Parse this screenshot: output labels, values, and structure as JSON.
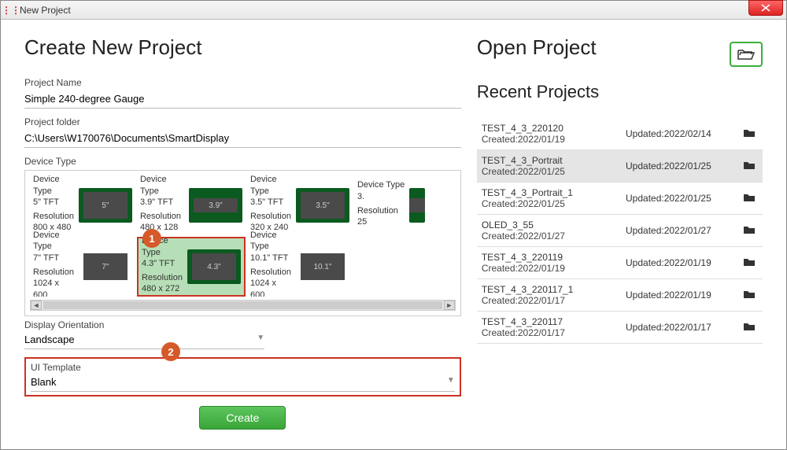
{
  "window": {
    "title": "New Project"
  },
  "create": {
    "heading": "Create New Project",
    "project_name_label": "Project Name",
    "project_name_value": "Simple 240-degree Gauge",
    "project_folder_label": "Project folder",
    "project_folder_value": "C:\\Users\\W170076\\Documents\\SmartDisplay",
    "device_type_label": "Device Type",
    "devices": [
      {
        "type": "5\" TFT",
        "res": "800 x 480",
        "thumb": "5\"",
        "shape": "normal"
      },
      {
        "type": "3.9\" TFT",
        "res": "480 x 128",
        "thumb": "3.9\"",
        "shape": "thin"
      },
      {
        "type": "3.5\" TFT",
        "res": "320 x 240",
        "thumb": "3.5\"",
        "shape": "normal"
      },
      {
        "type": "3.",
        "res": "25",
        "thumb": "",
        "shape": "thin",
        "cutoff": true
      },
      {
        "type": "7\" TFT",
        "res": "1024 x 600",
        "thumb": "7\"",
        "shape": "normal",
        "nogreen": true
      },
      {
        "type": "4.3\" TFT",
        "res": "480 x 272",
        "thumb": "4.3\"",
        "shape": "normal",
        "selected": true
      },
      {
        "type": "10.1\" TFT",
        "res": "1024 x 600",
        "thumb": "10.1\"",
        "shape": "normal",
        "nogreen": true
      }
    ],
    "device_field_labels": {
      "type": "Device Type",
      "res": "Resolution"
    },
    "orientation_label": "Display Orientation",
    "orientation_value": "Landscape",
    "uitemplate_label": "UI Template",
    "uitemplate_value": "Blank",
    "create_button": "Create"
  },
  "open": {
    "heading": "Open Project",
    "recent_heading": "Recent Projects",
    "recent": [
      {
        "name": "TEST_4_3_220120",
        "created": "2022/01/19",
        "updated": "2022/02/14"
      },
      {
        "name": "TEST_4_3_Portrait",
        "created": "2022/01/25",
        "updated": "2022/01/25",
        "selected": true
      },
      {
        "name": "TEST_4_3_Portrait_1",
        "created": "2022/01/25",
        "updated": "2022/01/25"
      },
      {
        "name": "OLED_3_55",
        "created": "2022/01/27",
        "updated": "2022/01/27"
      },
      {
        "name": "TEST_4_3_220119",
        "created": "2022/01/19",
        "updated": "2022/01/19"
      },
      {
        "name": "TEST_4_3_220117_1",
        "created": "2022/01/17",
        "updated": "2022/01/19"
      },
      {
        "name": "TEST_4_3_220117",
        "created": "2022/01/17",
        "updated": "2022/01/17"
      }
    ],
    "created_prefix": "Created:",
    "updated_prefix": "Updated:"
  },
  "annotations": {
    "badge1": "1",
    "badge2": "2"
  }
}
